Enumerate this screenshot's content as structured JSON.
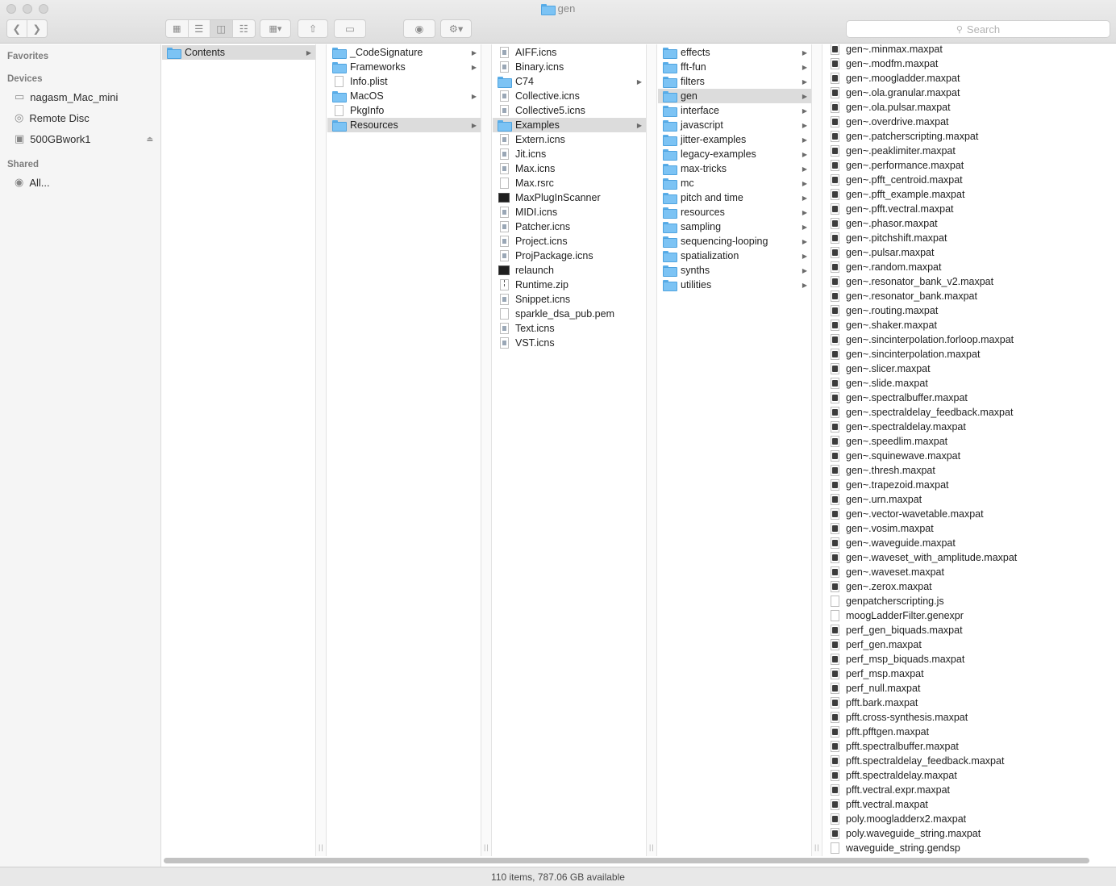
{
  "window": {
    "title": "gen",
    "title_icon": "folder-icon"
  },
  "toolbar": {
    "nav": [
      {
        "icon": "chevron-left-icon"
      },
      {
        "icon": "chevron-right-icon"
      }
    ],
    "view_modes": [
      {
        "icon": "icon-view-icon"
      },
      {
        "icon": "list-view-icon"
      },
      {
        "icon": "column-view-icon",
        "active": true
      },
      {
        "icon": "cover-flow-icon"
      }
    ],
    "arrange_icon": "arrange-icon",
    "share_icon": "share-icon",
    "tag_icon": "tag-icon",
    "quicklook_icon": "eye-icon",
    "action_icon": "gear-icon",
    "search_placeholder": "Search"
  },
  "sidebar": {
    "favorites_label": "Favorites",
    "devices_label": "Devices",
    "devices": [
      {
        "label": "nagasm_Mac_mini",
        "icon": "computer-icon"
      },
      {
        "label": "Remote Disc",
        "icon": "disc-icon"
      },
      {
        "label": "500GBwork1",
        "icon": "drive-icon",
        "ejectable": true
      }
    ],
    "shared_label": "Shared",
    "shared": [
      {
        "label": "All...",
        "icon": "network-icon"
      }
    ]
  },
  "columns": [
    {
      "items": [
        {
          "name": "Contents",
          "kind": "folder",
          "arrow": true,
          "selected": true
        }
      ]
    },
    {
      "items": [
        {
          "name": "_CodeSignature",
          "kind": "folder",
          "arrow": true
        },
        {
          "name": "Frameworks",
          "kind": "folder",
          "arrow": true
        },
        {
          "name": "Info.plist",
          "kind": "doc"
        },
        {
          "name": "MacOS",
          "kind": "folder",
          "arrow": true
        },
        {
          "name": "PkgInfo",
          "kind": "doc"
        },
        {
          "name": "Resources",
          "kind": "folder",
          "arrow": true,
          "selected": true
        }
      ]
    },
    {
      "items": [
        {
          "name": "AIFF.icns",
          "kind": "icns"
        },
        {
          "name": "Binary.icns",
          "kind": "icns"
        },
        {
          "name": "C74",
          "kind": "folder",
          "arrow": true
        },
        {
          "name": "Collective.icns",
          "kind": "icns"
        },
        {
          "name": "Collective5.icns",
          "kind": "icns"
        },
        {
          "name": "Examples",
          "kind": "folder",
          "arrow": true,
          "selected": true
        },
        {
          "name": "Extern.icns",
          "kind": "icns"
        },
        {
          "name": "Jit.icns",
          "kind": "icns"
        },
        {
          "name": "Max.icns",
          "kind": "icns"
        },
        {
          "name": "Max.rsrc",
          "kind": "doc"
        },
        {
          "name": "MaxPlugInScanner",
          "kind": "app"
        },
        {
          "name": "MIDI.icns",
          "kind": "icns"
        },
        {
          "name": "Patcher.icns",
          "kind": "icns"
        },
        {
          "name": "Project.icns",
          "kind": "icns"
        },
        {
          "name": "ProjPackage.icns",
          "kind": "icns"
        },
        {
          "name": "relaunch",
          "kind": "app"
        },
        {
          "name": "Runtime.zip",
          "kind": "zip"
        },
        {
          "name": "Snippet.icns",
          "kind": "icns"
        },
        {
          "name": "sparkle_dsa_pub.pem",
          "kind": "doc"
        },
        {
          "name": "Text.icns",
          "kind": "icns"
        },
        {
          "name": "VST.icns",
          "kind": "icns"
        }
      ]
    },
    {
      "items": [
        {
          "name": "effects",
          "kind": "folder",
          "arrow": true
        },
        {
          "name": "fft-fun",
          "kind": "folder",
          "arrow": true
        },
        {
          "name": "filters",
          "kind": "folder",
          "arrow": true
        },
        {
          "name": "gen",
          "kind": "folder",
          "arrow": true,
          "selected": true
        },
        {
          "name": "interface",
          "kind": "folder",
          "arrow": true
        },
        {
          "name": "javascript",
          "kind": "folder",
          "arrow": true
        },
        {
          "name": "jitter-examples",
          "kind": "folder",
          "arrow": true
        },
        {
          "name": "legacy-examples",
          "kind": "folder",
          "arrow": true
        },
        {
          "name": "max-tricks",
          "kind": "folder",
          "arrow": true
        },
        {
          "name": "mc",
          "kind": "folder",
          "arrow": true
        },
        {
          "name": "pitch and time",
          "kind": "folder",
          "arrow": true
        },
        {
          "name": "resources",
          "kind": "folder",
          "arrow": true
        },
        {
          "name": "sampling",
          "kind": "folder",
          "arrow": true
        },
        {
          "name": "sequencing-looping",
          "kind": "folder",
          "arrow": true
        },
        {
          "name": "spatialization",
          "kind": "folder",
          "arrow": true
        },
        {
          "name": "synths",
          "kind": "folder",
          "arrow": true
        },
        {
          "name": "utilities",
          "kind": "folder",
          "arrow": true
        }
      ]
    },
    {
      "items": [
        {
          "name": "gen~.minmax.maxpat",
          "kind": "patch"
        },
        {
          "name": "gen~.modfm.maxpat",
          "kind": "patch"
        },
        {
          "name": "gen~.moogladder.maxpat",
          "kind": "patch"
        },
        {
          "name": "gen~.ola.granular.maxpat",
          "kind": "patch"
        },
        {
          "name": "gen~.ola.pulsar.maxpat",
          "kind": "patch"
        },
        {
          "name": "gen~.overdrive.maxpat",
          "kind": "patch"
        },
        {
          "name": "gen~.patcherscripting.maxpat",
          "kind": "patch"
        },
        {
          "name": "gen~.peaklimiter.maxpat",
          "kind": "patch"
        },
        {
          "name": "gen~.performance.maxpat",
          "kind": "patch"
        },
        {
          "name": "gen~.pfft_centroid.maxpat",
          "kind": "patch"
        },
        {
          "name": "gen~.pfft_example.maxpat",
          "kind": "patch"
        },
        {
          "name": "gen~.pfft.vectral.maxpat",
          "kind": "patch"
        },
        {
          "name": "gen~.phasor.maxpat",
          "kind": "patch"
        },
        {
          "name": "gen~.pitchshift.maxpat",
          "kind": "patch"
        },
        {
          "name": "gen~.pulsar.maxpat",
          "kind": "patch"
        },
        {
          "name": "gen~.random.maxpat",
          "kind": "patch"
        },
        {
          "name": "gen~.resonator_bank_v2.maxpat",
          "kind": "patch"
        },
        {
          "name": "gen~.resonator_bank.maxpat",
          "kind": "patch"
        },
        {
          "name": "gen~.routing.maxpat",
          "kind": "patch"
        },
        {
          "name": "gen~.shaker.maxpat",
          "kind": "patch"
        },
        {
          "name": "gen~.sincinterpolation.forloop.maxpat",
          "kind": "patch"
        },
        {
          "name": "gen~.sincinterpolation.maxpat",
          "kind": "patch"
        },
        {
          "name": "gen~.slicer.maxpat",
          "kind": "patch"
        },
        {
          "name": "gen~.slide.maxpat",
          "kind": "patch"
        },
        {
          "name": "gen~.spectralbuffer.maxpat",
          "kind": "patch"
        },
        {
          "name": "gen~.spectraldelay_feedback.maxpat",
          "kind": "patch"
        },
        {
          "name": "gen~.spectraldelay.maxpat",
          "kind": "patch"
        },
        {
          "name": "gen~.speedlim.maxpat",
          "kind": "patch"
        },
        {
          "name": "gen~.squinewave.maxpat",
          "kind": "patch"
        },
        {
          "name": "gen~.thresh.maxpat",
          "kind": "patch"
        },
        {
          "name": "gen~.trapezoid.maxpat",
          "kind": "patch"
        },
        {
          "name": "gen~.urn.maxpat",
          "kind": "patch"
        },
        {
          "name": "gen~.vector-wavetable.maxpat",
          "kind": "patch"
        },
        {
          "name": "gen~.vosim.maxpat",
          "kind": "patch"
        },
        {
          "name": "gen~.waveguide.maxpat",
          "kind": "patch"
        },
        {
          "name": "gen~.waveset_with_amplitude.maxpat",
          "kind": "patch"
        },
        {
          "name": "gen~.waveset.maxpat",
          "kind": "patch"
        },
        {
          "name": "gen~.zerox.maxpat",
          "kind": "patch"
        },
        {
          "name": "genpatcherscripting.js",
          "kind": "doc"
        },
        {
          "name": "moogLadderFilter.genexpr",
          "kind": "doc"
        },
        {
          "name": "perf_gen_biquads.maxpat",
          "kind": "patch"
        },
        {
          "name": "perf_gen.maxpat",
          "kind": "patch"
        },
        {
          "name": "perf_msp_biquads.maxpat",
          "kind": "patch"
        },
        {
          "name": "perf_msp.maxpat",
          "kind": "patch"
        },
        {
          "name": "perf_null.maxpat",
          "kind": "patch"
        },
        {
          "name": "pfft.bark.maxpat",
          "kind": "patch"
        },
        {
          "name": "pfft.cross-synthesis.maxpat",
          "kind": "patch"
        },
        {
          "name": "pfft.pfftgen.maxpat",
          "kind": "patch"
        },
        {
          "name": "pfft.spectralbuffer.maxpat",
          "kind": "patch"
        },
        {
          "name": "pfft.spectraldelay_feedback.maxpat",
          "kind": "patch"
        },
        {
          "name": "pfft.spectraldelay.maxpat",
          "kind": "patch"
        },
        {
          "name": "pfft.vectral.expr.maxpat",
          "kind": "patch"
        },
        {
          "name": "pfft.vectral.maxpat",
          "kind": "patch"
        },
        {
          "name": "poly.moogladderx2.maxpat",
          "kind": "patch"
        },
        {
          "name": "poly.waveguide_string.maxpat",
          "kind": "patch"
        },
        {
          "name": "waveguide_string.gendsp",
          "kind": "doc"
        }
      ]
    }
  ],
  "status": {
    "text": "110 items, 787.06 GB available"
  },
  "colors": {
    "folder": "#7cc3f4",
    "selection": "#dcdcdc",
    "sidebar_bg": "#f5f5f5"
  }
}
